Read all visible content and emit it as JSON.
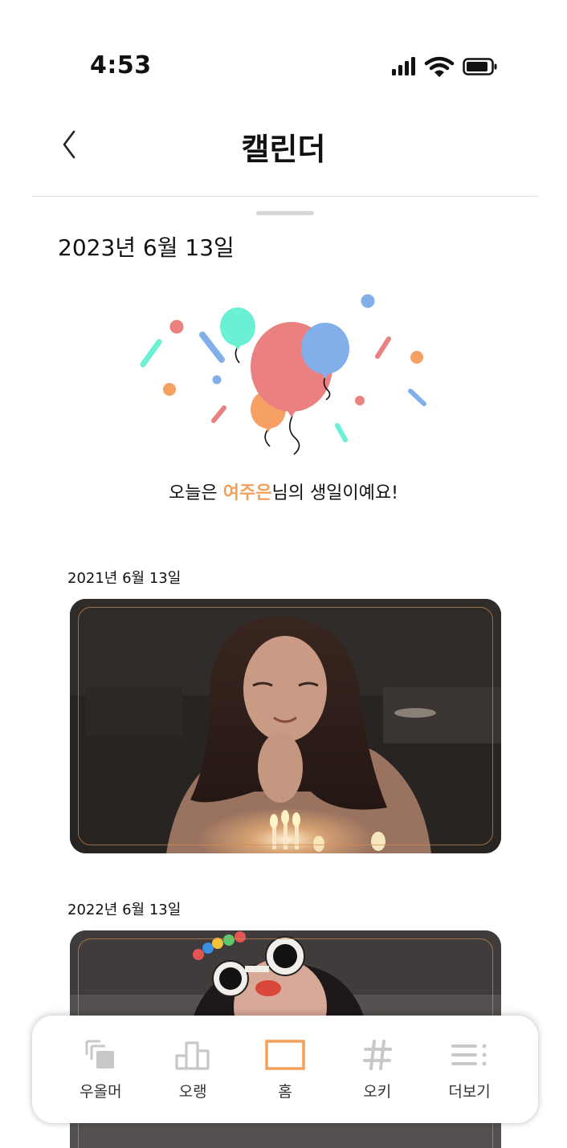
{
  "status_bar": {
    "time": "4:53",
    "icons": [
      "cellular-signal-icon",
      "wifi-icon",
      "battery-icon"
    ]
  },
  "header": {
    "back_icon": "chevron-left-icon",
    "title": "캘린더"
  },
  "current_date": "2023년 6월 13일",
  "birthday": {
    "illustration": "balloons-confetti-illustration",
    "message_prefix": "오늘은 ",
    "name": "여주은",
    "message_suffix": "님의 생일이예요!"
  },
  "memories": [
    {
      "date": "2021년 6월 13일",
      "photo": "birthday-photo-2021"
    },
    {
      "date": "2022년 6월 13일",
      "photo": "birthday-photo-2022"
    }
  ],
  "bottom_nav": {
    "items": [
      {
        "label": "우올머",
        "icon": "stacked-squares-icon",
        "active": false
      },
      {
        "label": "오랭",
        "icon": "bar-chart-icon",
        "active": false
      },
      {
        "label": "홈",
        "icon": "home-rectangle-icon",
        "active": true
      },
      {
        "label": "오키",
        "icon": "hashtag-icon",
        "active": false
      },
      {
        "label": "더보기",
        "icon": "menu-more-icon",
        "active": false
      }
    ]
  },
  "colors": {
    "accent": "#f3a05a",
    "nav_inactive": "#c8c8c8",
    "balloon_red": "#ea8080",
    "balloon_blue": "#82aee9",
    "balloon_mint": "#6af0d4",
    "balloon_orange": "#f6a066"
  }
}
